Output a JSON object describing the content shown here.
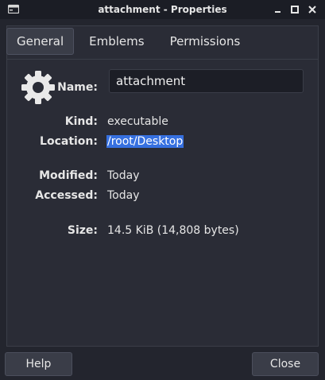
{
  "window": {
    "title": "attachment - Properties",
    "controls": [
      "minimize",
      "maximize",
      "close"
    ]
  },
  "tabs": [
    {
      "label": "General",
      "active": true
    },
    {
      "label": "Emblems",
      "active": false
    },
    {
      "label": "Permissions",
      "active": false
    }
  ],
  "general": {
    "icon": "gear-icon",
    "name_label": "Name:",
    "name_value": "attachment",
    "kind_label": "Kind:",
    "kind_value": "executable",
    "location_label": "Location:",
    "location_value": "/root/Desktop",
    "modified_label": "Modified:",
    "modified_value": "Today",
    "accessed_label": "Accessed:",
    "accessed_value": "Today",
    "size_label": "Size:",
    "size_value": "14.5 KiB (14,808 bytes)"
  },
  "buttons": {
    "help": "Help",
    "close": "Close"
  },
  "colors": {
    "background": "#23252e",
    "titlebar": "#1b1d25",
    "selection": "#3670e0"
  }
}
